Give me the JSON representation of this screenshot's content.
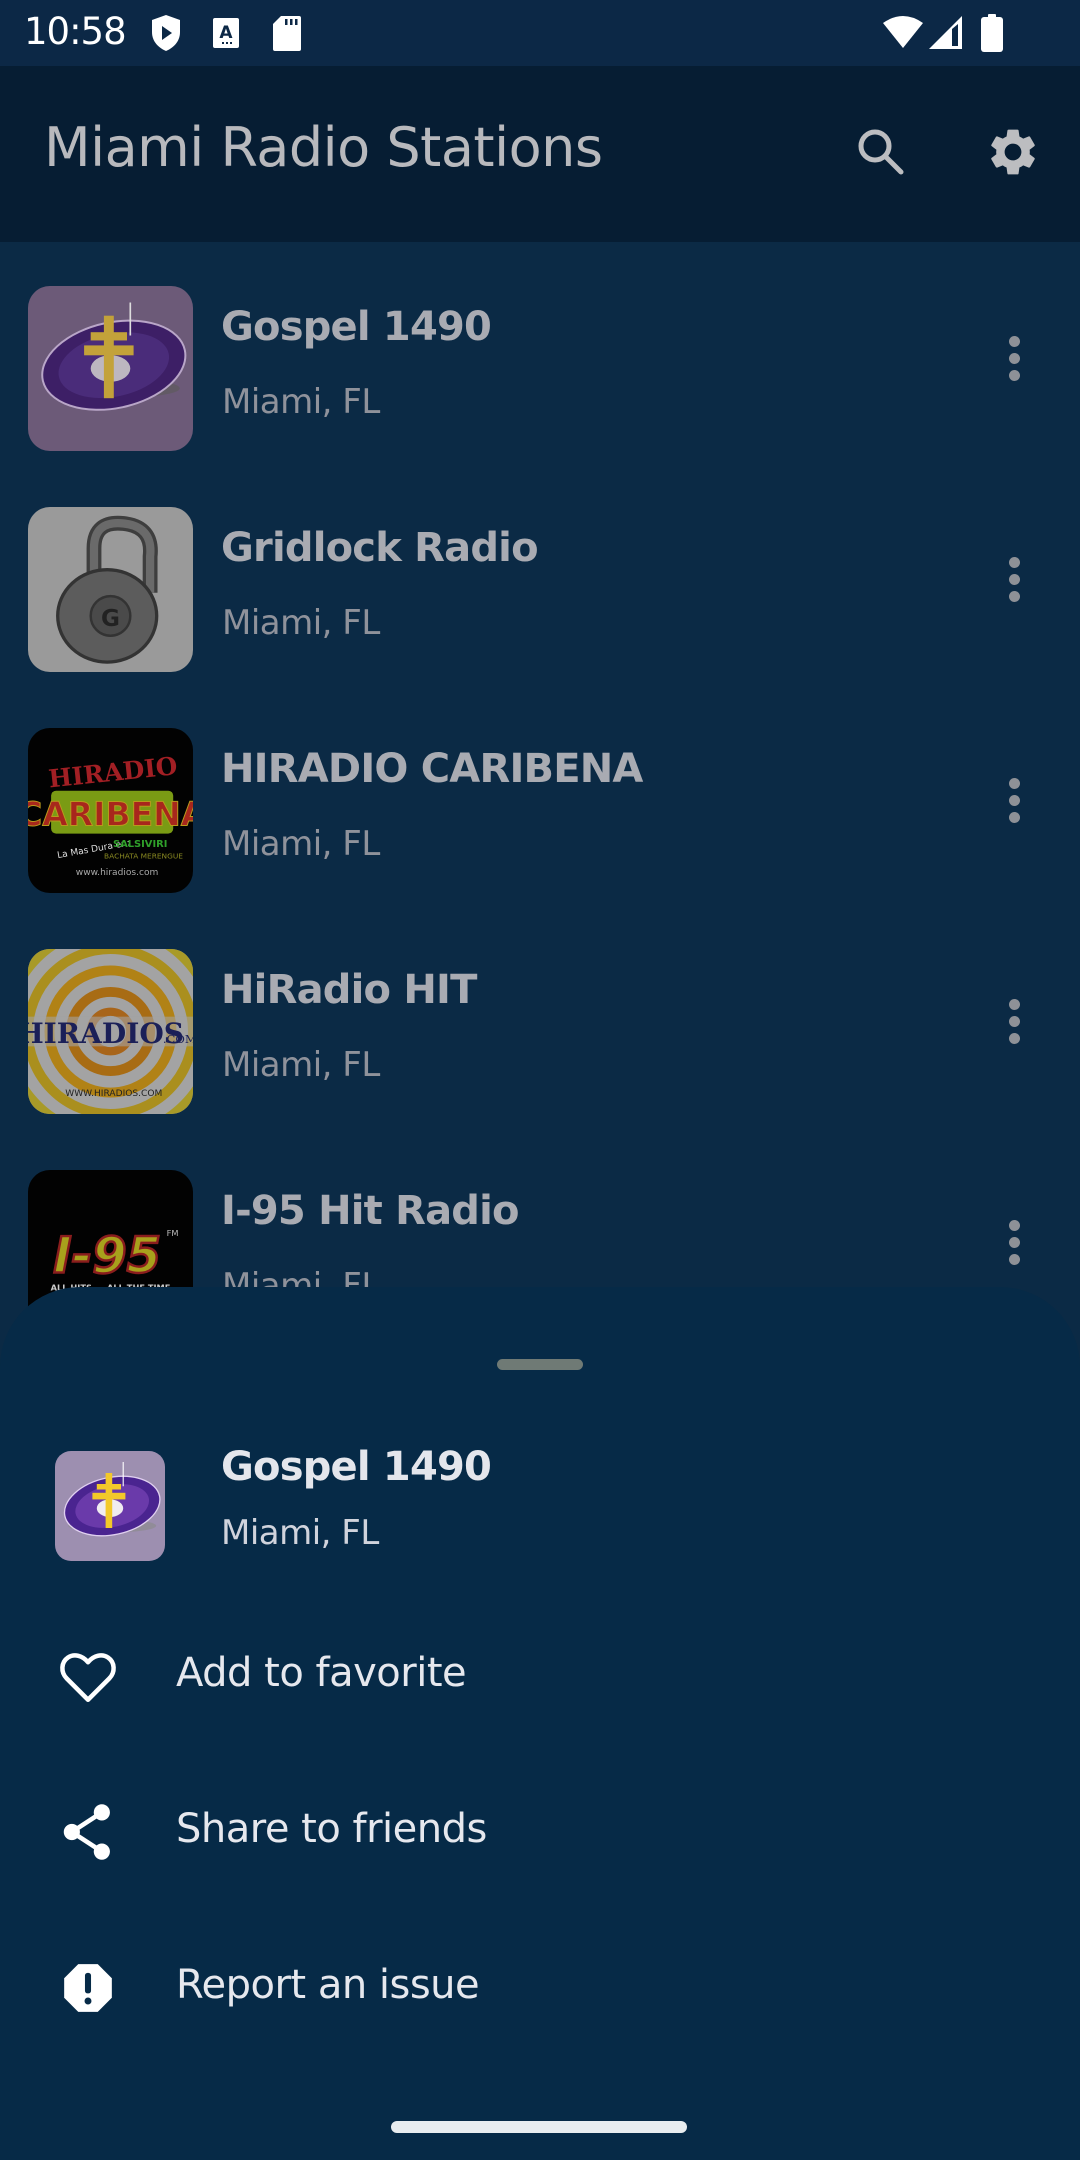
{
  "status_bar": {
    "time": "10:58",
    "left_icons": [
      "play-protect-icon",
      "keyboard-a-icon",
      "sd-card-icon"
    ],
    "right_icons": [
      "wifi-icon",
      "cell-signal-icon",
      "battery-icon"
    ]
  },
  "app_bar": {
    "title": "Miami Radio Stations",
    "actions": [
      {
        "name": "search",
        "icon": "search-icon"
      },
      {
        "name": "settings",
        "icon": "gear-icon"
      }
    ]
  },
  "stations": [
    {
      "name": "Gospel 1490",
      "location": "Miami, FL",
      "logo": "gospel-1490-logo"
    },
    {
      "name": "Gridlock Radio",
      "location": "Miami, FL",
      "logo": "gridlock-radio-logo"
    },
    {
      "name": "HIRADIO CARIBENA",
      "location": "Miami, FL",
      "logo": "hiradio-caribena-logo",
      "logo_text": [
        "HIRADIO",
        "CARIBENA",
        "La Mas Dura en: SALSIVIRI",
        "BACHATA MERENGUE",
        "www.hiradios.com"
      ]
    },
    {
      "name": "HiRadio HIT",
      "location": "Miami, FL",
      "logo": "hiradio-hit-logo",
      "logo_text": [
        "HIRADIOS",
        ".COM",
        "WWW.HIRADIOS.COM"
      ]
    },
    {
      "name": "I-95 Hit Radio",
      "location": "Miami, FL",
      "logo": "i95-logo",
      "logo_text": [
        "I-95",
        "FM",
        "ALL HITS ... ALL THE TIME"
      ]
    }
  ],
  "bottom_sheet": {
    "station": {
      "name": "Gospel 1490",
      "location": "Miami, FL"
    },
    "actions": [
      {
        "label": "Add to favorite",
        "icon": "heart-outline-icon"
      },
      {
        "label": "Share to friends",
        "icon": "share-icon"
      },
      {
        "label": "Report an issue",
        "icon": "report-octagon-icon"
      }
    ]
  },
  "colors": {
    "status_bar": "#0c2846",
    "app_bar": "#061d33",
    "list_bg_dimmed": "#0b2a45",
    "sheet_bg": "#062a47",
    "text_primary": "#e6e8ee"
  }
}
